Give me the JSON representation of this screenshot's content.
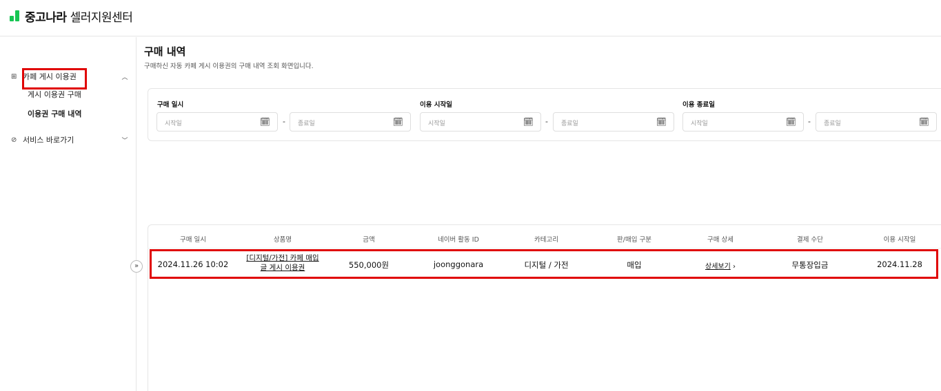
{
  "header": {
    "brand": "중고나라",
    "subtitle": "셀러지원센터"
  },
  "sidebar": {
    "groups": [
      {
        "label": "카페 게시 이용권",
        "icon": "grid-icon",
        "expanded": true
      },
      {
        "label": "서비스 바로가기",
        "icon": "link-icon",
        "expanded": false
      }
    ],
    "items": [
      {
        "label": "게시 이용권 구매"
      },
      {
        "label": "이용권 구매 내역",
        "active": true
      }
    ]
  },
  "page": {
    "title": "구매 내역",
    "description": "구매하신 자동 카페 게시 이용권의 구매 내역 조회 화면입니다."
  },
  "filters": {
    "purchase_date": {
      "label": "구매 일시",
      "start_placeholder": "시작일",
      "end_placeholder": "종료일"
    },
    "use_start_date": {
      "label": "이용 시작일",
      "start_placeholder": "시작일",
      "end_placeholder": "종료일"
    },
    "use_end_date": {
      "label": "이용 종료일",
      "start_placeholder": "시작일",
      "end_placeholder": "종료일"
    },
    "separator": "-"
  },
  "table": {
    "headers": [
      "구매 일시",
      "상품명",
      "금액",
      "네이버 활동 ID",
      "카테고리",
      "판/매입 구분",
      "구매 상세",
      "결제 수단",
      "이용 시작일"
    ],
    "rows": [
      {
        "purchase_datetime": "2024.11.26 10:02",
        "product_line1": "[디지털/가전] 카페 매입",
        "product_line2": "글 게시 이용권",
        "amount": "550,000원",
        "naver_id": "joonggonara",
        "category": "디지털 / 가전",
        "trade_type": "매입",
        "detail_link": "상세보기",
        "payment_method": "무통장입금",
        "use_start_date": "2024.11.28"
      }
    ]
  },
  "colors": {
    "brand": "#17c653",
    "highlight": "#e00000"
  }
}
